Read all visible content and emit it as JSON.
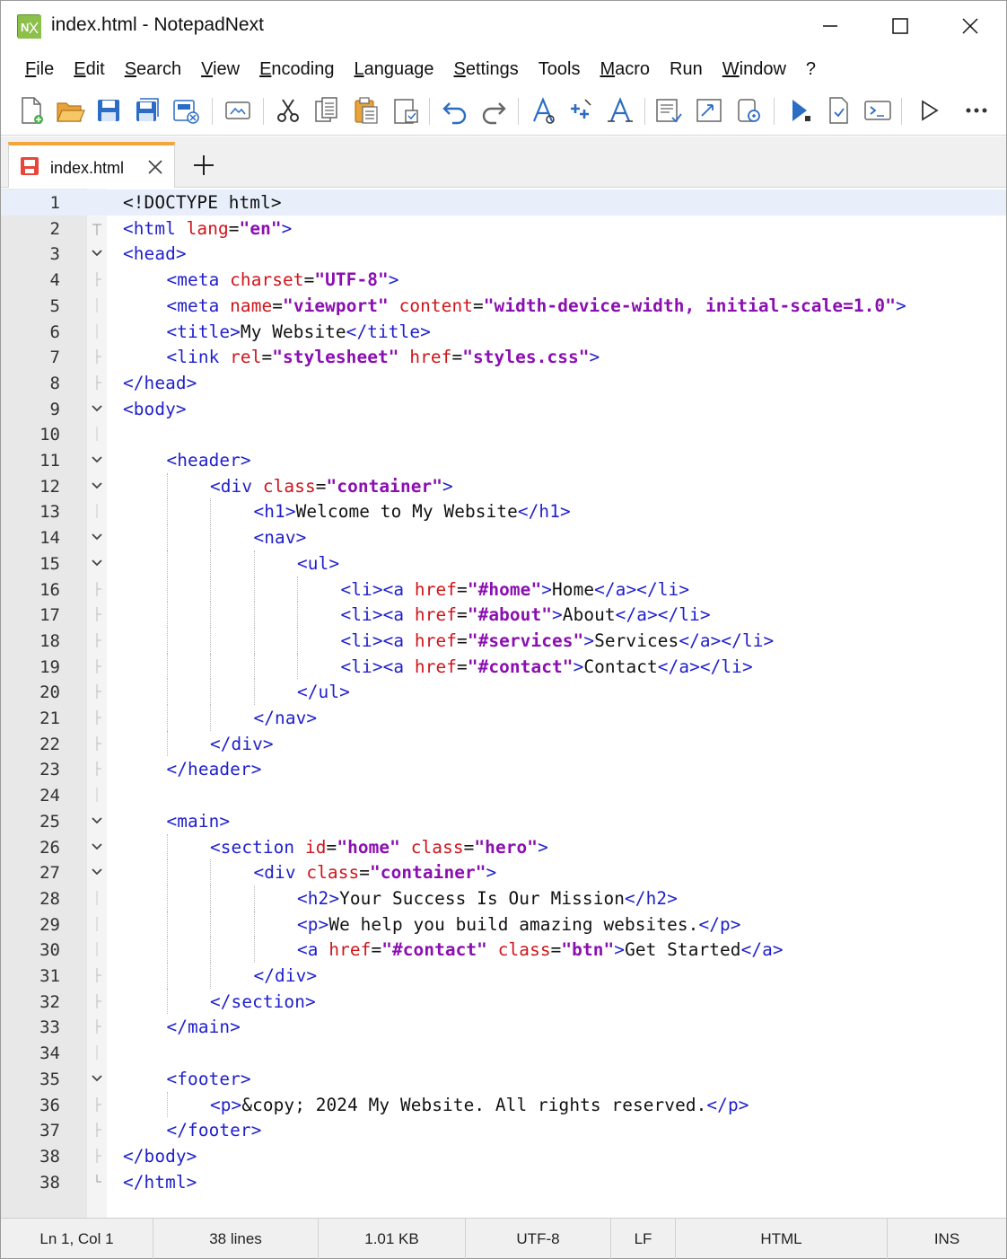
{
  "window": {
    "title": "index.html - NotepadNext",
    "app_icon_text": "N"
  },
  "menu": [
    {
      "label": "File",
      "mnemonic": "F",
      "rest": "ile"
    },
    {
      "label": "Edit",
      "mnemonic": "E",
      "rest": "dit"
    },
    {
      "label": "Search",
      "mnemonic": "S",
      "rest": "earch"
    },
    {
      "label": "View",
      "mnemonic": "V",
      "rest": "iew"
    },
    {
      "label": "Encoding",
      "mnemonic": "E",
      "rest": "ncoding"
    },
    {
      "label": "Language",
      "mnemonic": "L",
      "rest": "anguage"
    },
    {
      "label": "Settings",
      "mnemonic": "S",
      "rest": "ettings"
    },
    {
      "label": "Tools",
      "mnemonic": "",
      "rest": "Tools"
    },
    {
      "label": "Macro",
      "mnemonic": "M",
      "rest": "acro"
    },
    {
      "label": "Run",
      "mnemonic": "",
      "rest": "Run"
    },
    {
      "label": "Window",
      "mnemonic": "W",
      "rest": "indow"
    },
    {
      "label": "?",
      "mnemonic": "",
      "rest": "?"
    }
  ],
  "toolbar": {
    "icons": [
      "new-file-icon",
      "open-folder-icon",
      "save-icon",
      "save-all-icon",
      "close-all-icon",
      "print-preview-icon",
      "cut-icon",
      "copy-icon",
      "paste-icon",
      "paste-special-icon",
      "undo-icon",
      "redo-icon",
      "find-icon",
      "replace-icon",
      "find-in-files-icon",
      "show-whitespace-icon",
      "word-wrap-icon",
      "zoom-icon",
      "macro-record-icon",
      "macro-playback-icon",
      "macro-save-icon",
      "run-icon",
      "overflow-icon"
    ]
  },
  "tabs": [
    {
      "label": "index.html",
      "active": true
    }
  ],
  "tab_add_label": "+",
  "editor": {
    "current_line": 1,
    "lines": [
      {
        "n": "1",
        "indent": 0,
        "fold": "none",
        "tokens": [
          [
            "doc",
            "<!DOCTYPE html>"
          ]
        ]
      },
      {
        "n": "2",
        "indent": 0,
        "fold": "top",
        "tokens": [
          [
            "tag",
            "<html "
          ],
          [
            "attr",
            "lang"
          ],
          [
            "eq",
            "="
          ],
          [
            "str",
            "\"en\""
          ],
          [
            "tag",
            ">"
          ]
        ]
      },
      {
        "n": "3",
        "indent": 0,
        "fold": "open",
        "tokens": [
          [
            "tag",
            "<head>"
          ]
        ]
      },
      {
        "n": "4",
        "indent": 1,
        "fold": "mid",
        "tokens": [
          [
            "tag",
            "<meta "
          ],
          [
            "attr",
            "charset"
          ],
          [
            "eq",
            "="
          ],
          [
            "str",
            "\"UTF-8\""
          ],
          [
            "tag",
            ">"
          ]
        ]
      },
      {
        "n": "5",
        "indent": 1,
        "fold": "line",
        "tokens": [
          [
            "tag",
            "<meta "
          ],
          [
            "attr",
            "name"
          ],
          [
            "eq",
            "="
          ],
          [
            "str",
            "\"viewport\""
          ],
          [
            "txt",
            " "
          ],
          [
            "attr",
            "content"
          ],
          [
            "eq",
            "="
          ],
          [
            "str",
            "\"width-device-width, initial-scale=1.0\""
          ],
          [
            "tag",
            ">"
          ]
        ]
      },
      {
        "n": "6",
        "indent": 1,
        "fold": "line",
        "tokens": [
          [
            "tag",
            "<title>"
          ],
          [
            "txt",
            "My Website"
          ],
          [
            "tag",
            "</title>"
          ]
        ]
      },
      {
        "n": "7",
        "indent": 1,
        "fold": "mid",
        "tokens": [
          [
            "tag",
            "<link "
          ],
          [
            "attr",
            "rel"
          ],
          [
            "eq",
            "="
          ],
          [
            "str",
            "\"stylesheet\""
          ],
          [
            "txt",
            " "
          ],
          [
            "attr",
            "href"
          ],
          [
            "eq",
            "="
          ],
          [
            "str",
            "\"styles.css\""
          ],
          [
            "tag",
            ">"
          ]
        ]
      },
      {
        "n": "8",
        "indent": 0,
        "fold": "mid",
        "tokens": [
          [
            "tag",
            "</head>"
          ]
        ]
      },
      {
        "n": "9",
        "indent": 0,
        "fold": "open",
        "tokens": [
          [
            "tag",
            "<body>"
          ]
        ]
      },
      {
        "n": "10",
        "indent": 0,
        "fold": "line",
        "tokens": []
      },
      {
        "n": "11",
        "indent": 1,
        "fold": "open",
        "tokens": [
          [
            "tag",
            "<header>"
          ]
        ]
      },
      {
        "n": "12",
        "indent": 2,
        "fold": "open",
        "tokens": [
          [
            "tag",
            "<div "
          ],
          [
            "attr",
            "class"
          ],
          [
            "eq",
            "="
          ],
          [
            "str",
            "\"container\""
          ],
          [
            "tag",
            ">"
          ]
        ]
      },
      {
        "n": "13",
        "indent": 3,
        "fold": "line",
        "tokens": [
          [
            "tag",
            "<h1>"
          ],
          [
            "txt",
            "Welcome to My Website"
          ],
          [
            "tag",
            "</h1>"
          ]
        ]
      },
      {
        "n": "14",
        "indent": 3,
        "fold": "open",
        "tokens": [
          [
            "tag",
            "<nav>"
          ]
        ]
      },
      {
        "n": "15",
        "indent": 4,
        "fold": "open",
        "tokens": [
          [
            "tag",
            "<ul>"
          ]
        ]
      },
      {
        "n": "16",
        "indent": 5,
        "fold": "mid",
        "tokens": [
          [
            "tag",
            "<li><a "
          ],
          [
            "attr",
            "href"
          ],
          [
            "eq",
            "="
          ],
          [
            "str",
            "\"#home\""
          ],
          [
            "tag",
            ">"
          ],
          [
            "txt",
            "Home"
          ],
          [
            "tag",
            "</a></li>"
          ]
        ]
      },
      {
        "n": "17",
        "indent": 5,
        "fold": "mid",
        "tokens": [
          [
            "tag",
            "<li><a "
          ],
          [
            "attr",
            "href"
          ],
          [
            "eq",
            "="
          ],
          [
            "str",
            "\"#about\""
          ],
          [
            "tag",
            ">"
          ],
          [
            "txt",
            "About"
          ],
          [
            "tag",
            "</a></li>"
          ]
        ]
      },
      {
        "n": "18",
        "indent": 5,
        "fold": "mid",
        "tokens": [
          [
            "tag",
            "<li><a "
          ],
          [
            "attr",
            "href"
          ],
          [
            "eq",
            "="
          ],
          [
            "str",
            "\"#services\""
          ],
          [
            "tag",
            ">"
          ],
          [
            "txt",
            "Services"
          ],
          [
            "tag",
            "</a></li>"
          ]
        ]
      },
      {
        "n": "19",
        "indent": 5,
        "fold": "mid",
        "tokens": [
          [
            "tag",
            "<li><a "
          ],
          [
            "attr",
            "href"
          ],
          [
            "eq",
            "="
          ],
          [
            "str",
            "\"#contact\""
          ],
          [
            "tag",
            ">"
          ],
          [
            "txt",
            "Contact"
          ],
          [
            "tag",
            "</a></li>"
          ]
        ]
      },
      {
        "n": "20",
        "indent": 4,
        "fold": "mid",
        "tokens": [
          [
            "tag",
            "</ul>"
          ]
        ]
      },
      {
        "n": "21",
        "indent": 3,
        "fold": "mid",
        "tokens": [
          [
            "tag",
            "</nav>"
          ]
        ]
      },
      {
        "n": "22",
        "indent": 2,
        "fold": "mid",
        "tokens": [
          [
            "tag",
            "</div>"
          ]
        ]
      },
      {
        "n": "23",
        "indent": 1,
        "fold": "mid",
        "tokens": [
          [
            "tag",
            "</header>"
          ]
        ]
      },
      {
        "n": "24",
        "indent": 0,
        "fold": "line",
        "tokens": []
      },
      {
        "n": "25",
        "indent": 1,
        "fold": "open",
        "tokens": [
          [
            "tag",
            "<main>"
          ]
        ]
      },
      {
        "n": "26",
        "indent": 2,
        "fold": "open",
        "tokens": [
          [
            "tag",
            "<section "
          ],
          [
            "attr",
            "id"
          ],
          [
            "eq",
            "="
          ],
          [
            "str",
            "\"home\""
          ],
          [
            "txt",
            " "
          ],
          [
            "attr",
            "class"
          ],
          [
            "eq",
            "="
          ],
          [
            "str",
            "\"hero\""
          ],
          [
            "tag",
            ">"
          ]
        ]
      },
      {
        "n": "27",
        "indent": 3,
        "fold": "open",
        "tokens": [
          [
            "tag",
            "<div "
          ],
          [
            "attr",
            "class"
          ],
          [
            "eq",
            "="
          ],
          [
            "str",
            "\"container\""
          ],
          [
            "tag",
            ">"
          ]
        ]
      },
      {
        "n": "28",
        "indent": 4,
        "fold": "line",
        "tokens": [
          [
            "tag",
            "<h2>"
          ],
          [
            "txt",
            "Your Success Is Our Mission"
          ],
          [
            "tag",
            "</h2>"
          ]
        ]
      },
      {
        "n": "29",
        "indent": 4,
        "fold": "line",
        "tokens": [
          [
            "tag",
            "<p>"
          ],
          [
            "txt",
            "We help you build amazing websites."
          ],
          [
            "tag",
            "</p>"
          ]
        ]
      },
      {
        "n": "30",
        "indent": 4,
        "fold": "line",
        "tokens": [
          [
            "tag",
            "<a "
          ],
          [
            "attr",
            "href"
          ],
          [
            "eq",
            "="
          ],
          [
            "str",
            "\"#contact\""
          ],
          [
            "txt",
            " "
          ],
          [
            "attr",
            "class"
          ],
          [
            "eq",
            "="
          ],
          [
            "str",
            "\"btn\""
          ],
          [
            "tag",
            ">"
          ],
          [
            "txt",
            "Get Started"
          ],
          [
            "tag",
            "</a>"
          ]
        ]
      },
      {
        "n": "31",
        "indent": 3,
        "fold": "mid",
        "tokens": [
          [
            "tag",
            "</div>"
          ]
        ]
      },
      {
        "n": "32",
        "indent": 2,
        "fold": "mid",
        "tokens": [
          [
            "tag",
            "</section>"
          ]
        ]
      },
      {
        "n": "33",
        "indent": 1,
        "fold": "mid",
        "tokens": [
          [
            "tag",
            "</main>"
          ]
        ]
      },
      {
        "n": "34",
        "indent": 0,
        "fold": "line",
        "tokens": []
      },
      {
        "n": "35",
        "indent": 1,
        "fold": "open",
        "tokens": [
          [
            "tag",
            "<footer>"
          ]
        ]
      },
      {
        "n": "36",
        "indent": 2,
        "fold": "mid",
        "tokens": [
          [
            "tag",
            "<p>"
          ],
          [
            "txt",
            "&copy; 2024 My Website. All rights reserved."
          ],
          [
            "tag",
            "</p>"
          ]
        ]
      },
      {
        "n": "37",
        "indent": 1,
        "fold": "mid",
        "tokens": [
          [
            "tag",
            "</footer>"
          ]
        ]
      },
      {
        "n": "38",
        "indent": 0,
        "fold": "mid",
        "tokens": [
          [
            "tag",
            "</body>"
          ]
        ]
      },
      {
        "n": "38",
        "indent": 0,
        "fold": "end",
        "tokens": [
          [
            "tag",
            "</html>"
          ]
        ]
      }
    ]
  },
  "status": {
    "position": "Ln 1,  Col 1",
    "lines": "38 lines",
    "size": "1.01 KB",
    "encoding": "UTF-8",
    "eol": "LF",
    "language": "HTML",
    "mode": "INS"
  },
  "colors": {
    "tag": "#1f1fcc",
    "attr": "#d0141a",
    "string": "#8b0fb0",
    "tab_accent": "#f3a43a",
    "current_line": "#e8eefa"
  }
}
